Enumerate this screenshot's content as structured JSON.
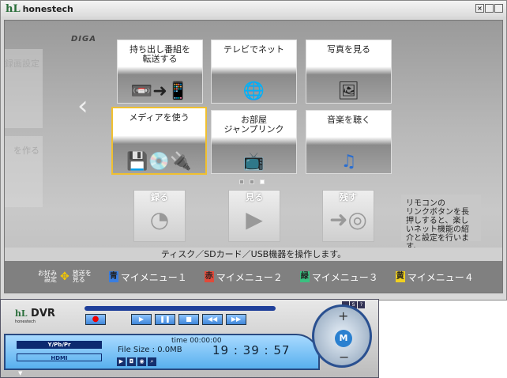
{
  "window": {
    "title": "honestech",
    "logo": "hL"
  },
  "ghost_tiles": [
    "録画設定",
    "を作る"
  ],
  "brand": "DIGA",
  "tiles": [
    {
      "label": "持ち出し番組を\n転送する",
      "icon": "transfer-icon"
    },
    {
      "label": "テレビでネット",
      "icon": "globe-icon"
    },
    {
      "label": "写真を見る",
      "icon": "photo-frame-icon"
    },
    {
      "label": "メディアを使う",
      "icon": "media-icon",
      "selected": true
    },
    {
      "label": "お部屋\nジャンプリンク",
      "icon": "tv-link-icon"
    },
    {
      "label": "音楽を聴く",
      "icon": "music-note-icon"
    }
  ],
  "page_dots": {
    "count": 3,
    "active": 3
  },
  "bottom_buttons": [
    {
      "label": "録る",
      "icon": "clock-icon"
    },
    {
      "label": "見る",
      "icon": "film-play-icon"
    },
    {
      "label": "残す",
      "icon": "disc-icon"
    }
  ],
  "info_text": "リモコンの\nリンクボタンを長押しすると、楽しいネット機能の紹介と設定を行います。",
  "status_text": "ティスク／SDカード／USB機器を操作します。",
  "footer": {
    "nav_left": "お好み\n設定",
    "nav_right": "放送を\n見る",
    "menus": [
      {
        "key": "青",
        "label": "マイメニュー１",
        "color": "#3a7ee0"
      },
      {
        "key": "赤",
        "label": "マイメニュー２",
        "color": "#e04a3a"
      },
      {
        "key": "緑",
        "label": "マイメニュー３",
        "color": "#3ac080"
      },
      {
        "key": "黄",
        "label": "マイメニュー４",
        "color": "#f0d020"
      }
    ]
  },
  "dvr": {
    "logo": "hL",
    "company": "honestech",
    "title": "DVR",
    "source1": "Y/Pb/Pr",
    "source2": "HDMI",
    "time_label": "time",
    "time_value": "00:00:00",
    "file_size_label": "File Size :",
    "file_size_value": "0.0MB",
    "clock": "19 : 39 : 57",
    "knob": {
      "plus": "+",
      "center": "M",
      "minus": "−"
    }
  }
}
